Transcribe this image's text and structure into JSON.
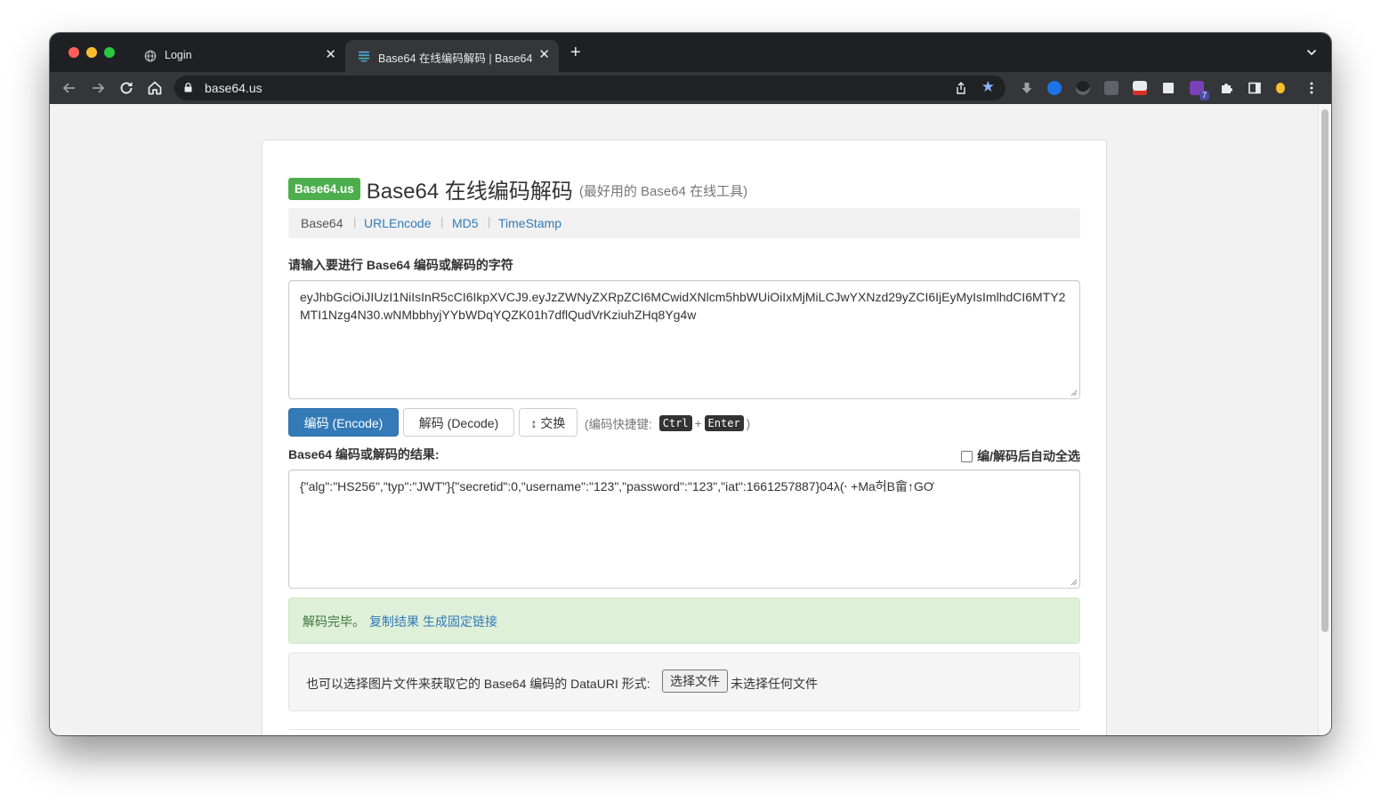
{
  "browser": {
    "tabs": [
      {
        "title": "Login",
        "icon": "globe-icon"
      },
      {
        "title": "Base64 在线编码解码 | Base64",
        "icon": "base64-favicon"
      }
    ],
    "new_tab_label": "+",
    "close_glyph": "✕",
    "url": "base64.us",
    "star_glyph": "★",
    "extension_badge": "7"
  },
  "page": {
    "brand_badge": "Base64.us",
    "title": "Base64 在线编码解码",
    "title_suffix": "(最好用的 Base64 在线工具)",
    "nav": [
      {
        "label": "Base64",
        "active": true
      },
      {
        "label": "URLEncode",
        "active": false
      },
      {
        "label": "MD5",
        "active": false
      },
      {
        "label": "TimeStamp",
        "active": false
      }
    ],
    "nav_separator": "|",
    "input_label": "请输入要进行 Base64 编码或解码的字符",
    "input_value": "eyJhbGciOiJIUzI1NiIsInR5cCI6IkpXVCJ9.eyJzZWNyZXRpZCI6MCwidXNlcm5hbWUiOiIxMjMiLCJwYXNzd29yZCI6IjEyMyIsImlhdCI6MTY2MTI1Nzg4N30.wNMbbhyjYYbWDqYQZK01h7dflQudVrKziuhZHq8Yg4w",
    "encode_button": "编码 (Encode)",
    "decode_button": "解码 (Decode)",
    "swap_button": "↕ 交换",
    "shortcut_prefix": "(编码快捷键:",
    "shortcut_key1": "Ctrl",
    "shortcut_plus": "+",
    "shortcut_key2": "Enter",
    "shortcut_suffix": ")",
    "result_label": "Base64 编码或解码的结果:",
    "auto_select_label": "编/解码后自动全选",
    "result_value": "{\"alg\":\"HS256\",\"typ\":\"JWT\"}{\"secretid\":0,\"username\":\"123\",\"password\":\"123\",\"iat\":1661257887}04λ(⸱ +Ma허B畲↑GƠ",
    "status_message": "解码完毕。",
    "copy_link": "复制结果",
    "permalink_link": "生成固定链接",
    "file_prompt": "也可以选择图片文件来获取它的 Base64 编码的 DataURI 形式:",
    "file_button": "选择文件",
    "no_file_text": "未选择任何文件"
  },
  "colors": {
    "brand_green": "#4cae4c",
    "primary_blue": "#337ab7",
    "link_blue": "#337ab7",
    "success_bg": "#dff0d8",
    "success_text": "#3c763d",
    "browser_dark": "#1f2023",
    "browser_toolbar": "#35363a"
  }
}
